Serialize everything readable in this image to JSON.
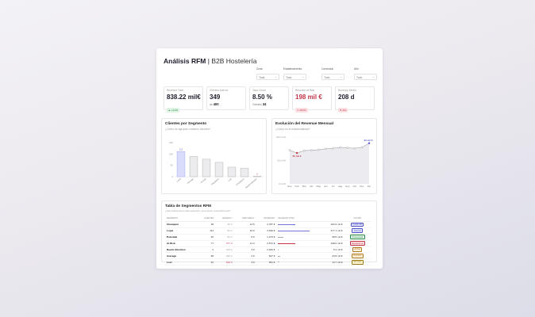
{
  "header": {
    "title": "Análisis RFM",
    "separator": "|",
    "subtitle": "B2B Hostelería"
  },
  "filters": [
    {
      "label": "Zona",
      "value": "Toda"
    },
    {
      "label": "Establecimiento",
      "value": "Todo"
    },
    {
      "label": "Comercial",
      "value": "Todo"
    },
    {
      "label": "Año",
      "value": "Todo"
    }
  ],
  "kpis": [
    {
      "label": "Revenue Total",
      "value": "838.22 mil€",
      "badge": "▲ +3.2%",
      "badge_color": "green",
      "value_color": "normal"
    },
    {
      "label": "Clientes Activos",
      "value": "349",
      "sub_prefix": "de",
      "sub_value": "400"
    },
    {
      "label": "Tasa Churn",
      "value": "8.50 %",
      "sub_prefix": "Clientes",
      "sub_value": "34"
    },
    {
      "label": "Revenue at Risk",
      "value": "198 mil €",
      "badge": "⚠ 28.6%",
      "badge_color": "red",
      "value_color": "red"
    },
    {
      "label": "Recency Medio",
      "value": "208 d",
      "badge": "▼ Alto",
      "badge_color": "red",
      "value_color": "normal"
    }
  ],
  "segments_card": {
    "title": "Clientes por Segmento",
    "subtitle": "¿Cómo se agrupan nuestros clientes?"
  },
  "revenue_card": {
    "title": "Evolución del Revenue Mensual",
    "subtitle": "¿Cómo es la estacionalidad?"
  },
  "chart_data": [
    {
      "type": "bar",
      "title": "Clientes por Segmento",
      "categories": [
        "Loyal",
        "Average",
        "At Risk",
        "Regulares",
        "Lost",
        "Champions",
        "Needs Attention"
      ],
      "values": [
        111,
        89,
        77,
        63,
        42,
        38,
        2
      ],
      "highlight_first": true,
      "yticks": [
        "0",
        "50",
        "100",
        "150"
      ],
      "ylim": [
        0,
        150
      ],
      "annotation_first": "111",
      "annotation_last": "2",
      "colors": {
        "first": "#d9dcfb",
        "first_border": "#8a91ea",
        "rest": "#ececef",
        "rest_border": "#9a9aa3",
        "last_label": "#c23646"
      }
    },
    {
      "type": "area",
      "title": "Evolución del Revenue Mensual",
      "categories": [
        "Ene",
        "Feb",
        "Mar",
        "Abr",
        "May",
        "Jun",
        "Jul",
        "Ago",
        "Sep",
        "Oct",
        "Nov",
        "Dic"
      ],
      "values": [
        72,
        66,
        71,
        72,
        73,
        75,
        76,
        78,
        77,
        76,
        78,
        87
      ],
      "yticks": [
        "100 mil €",
        "50 mil €",
        "0 mil €"
      ],
      "ylim": [
        0,
        100
      ],
      "annotation_min": "65 mil €",
      "annotation_max": "93 mil €",
      "colors": {
        "line": "#7a7a86",
        "fill": "#ececf0",
        "max": "#5a5fd6",
        "min": "#c23646"
      }
    }
  ],
  "table": {
    "title": "Tabla de Segmentos RFM",
    "subtitle": "¿Qué caracteriza a cada segmento y qué acción comercial tomar?",
    "columns": [
      "SEGMENTO",
      "CLIENTES",
      "RECENCY",
      "FRECUENCY",
      "MONETARY",
      "REVENUE TOTAL",
      "ACCIÓN"
    ],
    "rows": [
      {
        "segment": "Champion",
        "clients": "38",
        "recency": "35 d",
        "freq": "14.5",
        "monetary": "4,787 €",
        "revenue": "162.6 mil €",
        "bar": 0.55,
        "bar_color": "#7076de",
        "action": "Cuidar VIP",
        "tag_bg": "#e7e8fd",
        "tag_fg": "#4c53c9",
        "recency_warn": false
      },
      {
        "segment": "Loyal",
        "clients": "111",
        "recency": "83 d",
        "freq": "10.9",
        "monetary": "3,460 €",
        "revenue": "377.1 mil €",
        "bar": 1.0,
        "bar_color": "#7076de",
        "action": "Fidelizar",
        "tag_bg": "#e7e8fd",
        "tag_fg": "#4c53c9",
        "recency_warn": false
      },
      {
        "segment": "Potential",
        "clients": "46",
        "recency": "84 d",
        "freq": "6.9",
        "monetary": "1,273 €",
        "revenue": "58.5 mil €",
        "bar": 0.16,
        "bar_color": "#aaaaaa",
        "action": "Cross-Upsell",
        "tag_bg": "#e4f5ea",
        "tag_fg": "#2c8a48",
        "recency_warn": false
      },
      {
        "segment": "At Risk",
        "clients": "77",
        "recency": "377 d",
        "freq": "11.3",
        "monetary": "2,572 €",
        "revenue": "198.0 mil €",
        "bar": 0.55,
        "bar_color": "#c23646",
        "action": "Recuperar ya",
        "tag_bg": "#fde3e6",
        "tag_fg": "#c23646",
        "recency_warn": true
      },
      {
        "segment": "Needs Attention",
        "clients": "2",
        "recency": "109 d",
        "freq": "3.0",
        "monetary": "2,620 €",
        "revenue": "5.2 mil €",
        "bar": 0.02,
        "bar_color": "#aaaaaa",
        "action": "Activar",
        "tag_bg": "#fdf1de",
        "tag_fg": "#b57a1c",
        "recency_warn": false
      },
      {
        "segment": "Average",
        "clients": "89",
        "recency": "290 d",
        "freq": "2.9",
        "monetary": "627 €",
        "revenue": "23.9 mil €",
        "bar": 0.06,
        "bar_color": "#aaaaaa",
        "action": "Reactivar",
        "tag_bg": "#fdf1de",
        "tag_fg": "#b57a1c",
        "recency_warn": false
      },
      {
        "segment": "Lost",
        "clients": "42",
        "recency": "649 d",
        "freq": "3.0",
        "monetary": "351 €",
        "revenue": "14.7 mil €",
        "bar": 0.04,
        "bar_color": "#aaaaaa",
        "action": "Win-back",
        "tag_bg": "#fdf6d8",
        "tag_fg": "#9a7a10",
        "recency_warn": true
      }
    ]
  }
}
